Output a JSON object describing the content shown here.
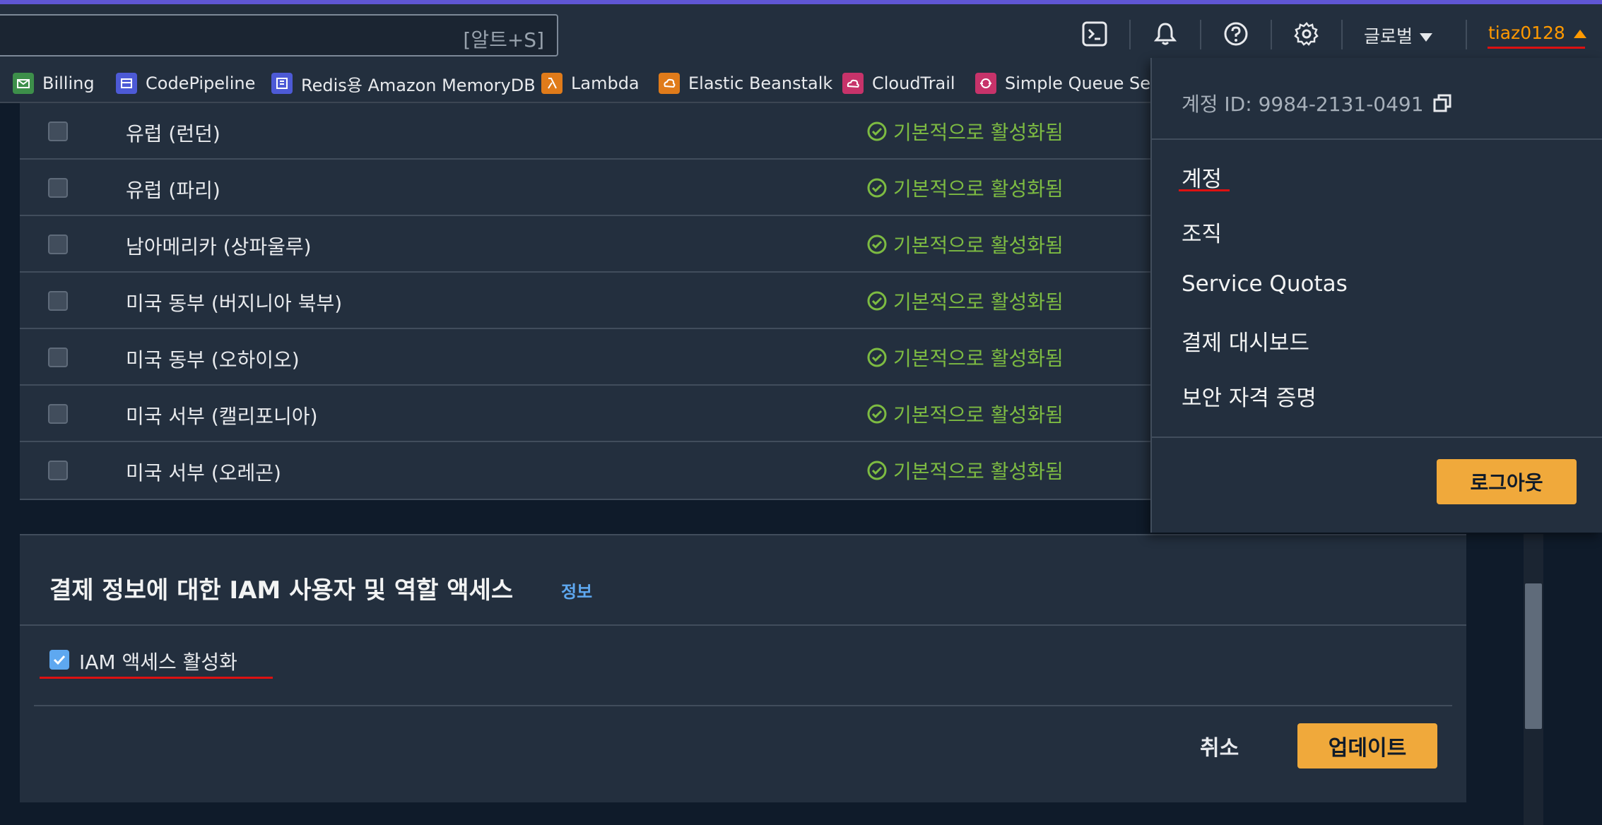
{
  "topbar": {
    "search_shortcut": "[알트+S]",
    "region": "글로벌",
    "username": "tiaz0128"
  },
  "favorites": [
    {
      "label": "Billing",
      "color": "#3d8f4a"
    },
    {
      "label": "CodePipeline",
      "color": "#4d5ad6"
    },
    {
      "label": "Redis용 Amazon MemoryDB",
      "color": "#4d5ad6"
    },
    {
      "label": "Lambda",
      "color": "#e07b1a"
    },
    {
      "label": "Elastic Beanstalk",
      "color": "#e07b1a"
    },
    {
      "label": "CloudTrail",
      "color": "#c7336a"
    },
    {
      "label": "Simple Queue Serv",
      "color": "#c7336a"
    }
  ],
  "regions_table": {
    "rows": [
      {
        "name": "유럽 (런던)",
        "status": "기본적으로 활성화됨"
      },
      {
        "name": "유럽 (파리)",
        "status": "기본적으로 활성화됨"
      },
      {
        "name": "남아메리카 (상파울루)",
        "status": "기본적으로 활성화됨"
      },
      {
        "name": "미국 동부 (버지니아 북부)",
        "status": "기본적으로 활성화됨"
      },
      {
        "name": "미국 동부 (오하이오)",
        "status": "기본적으로 활성화됨"
      },
      {
        "name": "미국 서부 (캘리포니아)",
        "status": "기본적으로 활성화됨"
      },
      {
        "name": "미국 서부 (오레곤)",
        "status": "기본적으로 활성화됨"
      }
    ]
  },
  "iam_panel": {
    "title": "결제 정보에 대한 IAM 사용자 및 역할 액세스",
    "info_link": "정보",
    "checkbox_label": "IAM 액세스 활성화",
    "checked": true,
    "cancel_label": "취소",
    "update_label": "업데이트"
  },
  "account_menu": {
    "account_id": "계정 ID: 9984-2131-0491",
    "items": [
      "계정",
      "조직",
      "Service Quotas",
      "결제 대시보드",
      "보안 자격 증명"
    ],
    "logout_label": "로그아웃"
  },
  "colors": {
    "accent_orange": "#ff9900",
    "button_orange": "#f0a93b",
    "status_green": "#7dbb42",
    "link_blue": "#5ea8f0"
  }
}
